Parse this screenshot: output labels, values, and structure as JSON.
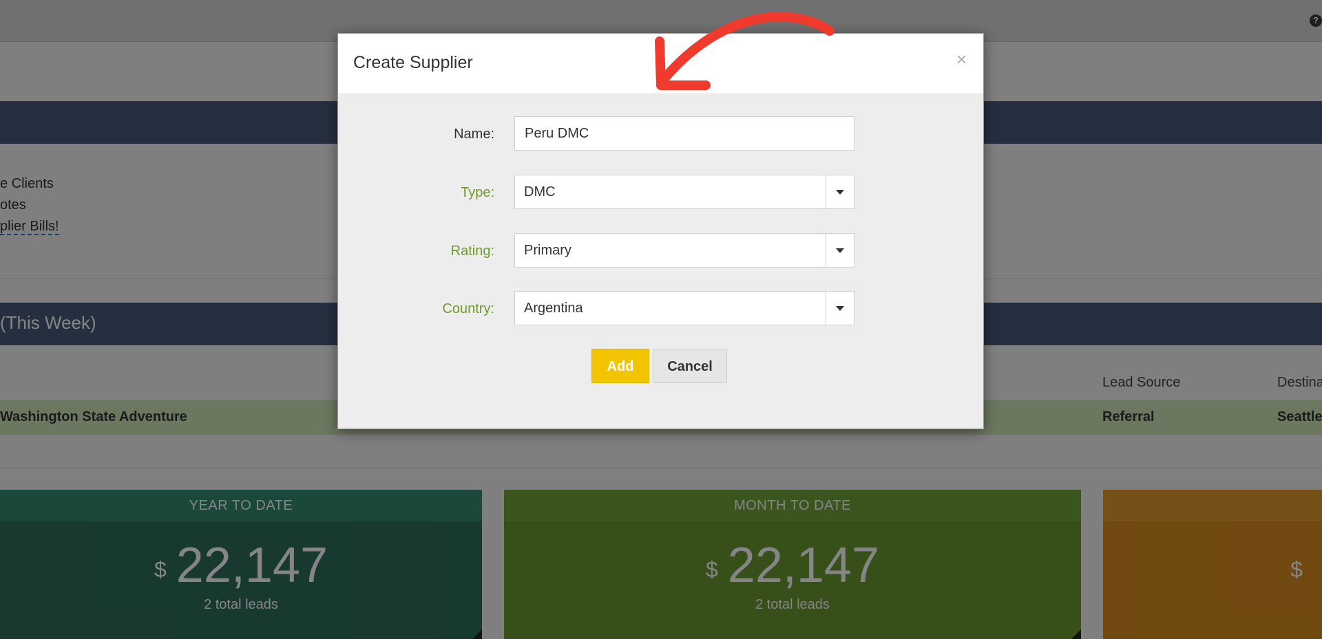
{
  "background": {
    "help_icon": "?",
    "links": {
      "active_clients": "e Clients",
      "quotes": "otes",
      "supplier_bills": "plier Bills!"
    },
    "week_section_title": "(This Week)",
    "table": {
      "headers": {
        "lead_source": "Lead Source",
        "destination": "Destina"
      },
      "row": {
        "trip": "Washington State Adventure",
        "lead_source": "Referral",
        "destination": "Seattle"
      }
    },
    "cards": [
      {
        "title": "YEAR TO DATE",
        "currency": "$",
        "amount": "22,147",
        "sub": "2 total leads"
      },
      {
        "title": "MONTH TO DATE",
        "currency": "$",
        "amount": "22,147",
        "sub": "2 total leads"
      },
      {
        "title": "",
        "currency": "$",
        "amount": "",
        "sub": ""
      }
    ]
  },
  "modal": {
    "title": "Create Supplier",
    "close": "×",
    "fields": {
      "name": {
        "label": "Name:",
        "value": "Peru DMC"
      },
      "type": {
        "label": "Type:",
        "value": "DMC"
      },
      "rating": {
        "label": "Rating:",
        "value": "Primary"
      },
      "country": {
        "label": "Country:",
        "value": "Argentina"
      }
    },
    "buttons": {
      "add": "Add",
      "cancel": "Cancel"
    }
  },
  "colors": {
    "accent_yellow": "#f2c500",
    "annotation_red": "#f03a2e",
    "label_green": "#6f9b2c",
    "band_navy": "#4a5b7a"
  },
  "icons": {
    "help": "question-circle-icon",
    "close": "close-icon",
    "dropdown": "caret-down-icon",
    "annotation": "curved-arrow-icon"
  }
}
